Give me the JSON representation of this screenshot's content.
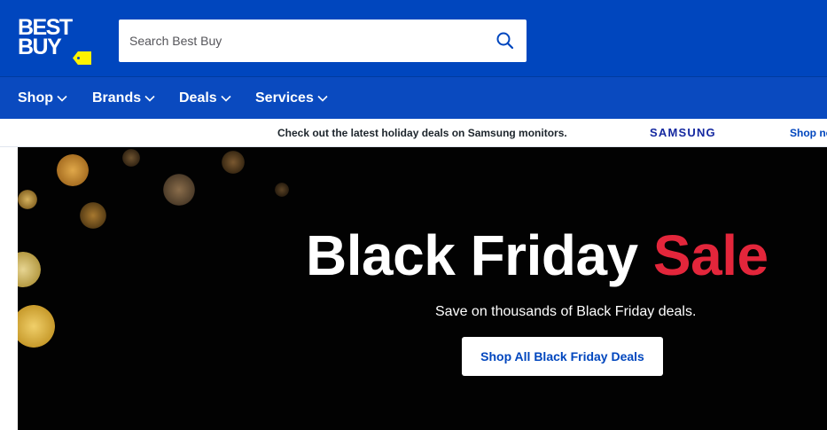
{
  "header": {
    "logo": {
      "line1": "BEST",
      "line2": "BUY",
      "tag_color": "#fff200"
    },
    "background": "#0046be",
    "search": {
      "placeholder": "Search Best Buy",
      "value": "",
      "icon": "search-icon"
    }
  },
  "nav": {
    "items": [
      {
        "label": "Shop",
        "icon": "chevron-down-icon"
      },
      {
        "label": "Brands",
        "icon": "chevron-down-icon"
      },
      {
        "label": "Deals",
        "icon": "chevron-down-icon"
      },
      {
        "label": "Services",
        "icon": "chevron-down-icon"
      }
    ]
  },
  "promo_banner": {
    "text": "Check out the latest holiday deals on Samsung monitors.",
    "brand": "SAMSUNG",
    "link": "Shop now"
  },
  "hero": {
    "title_main": "Black Friday",
    "title_accent": "Sale",
    "accent_color": "#e3263b",
    "subtitle": "Save on thousands of Black Friday deals.",
    "cta": "Shop All Black Friday Deals"
  }
}
